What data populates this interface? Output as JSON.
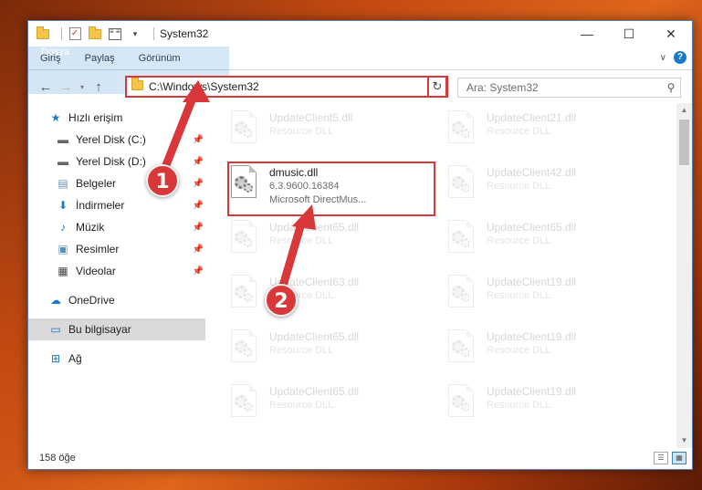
{
  "window": {
    "title": "System32"
  },
  "titlebar": {
    "minimize": "—",
    "maximize": "☐",
    "close": "✕"
  },
  "ribbon": {
    "tabs": [
      "Dosya",
      "Giriş",
      "Paylaş",
      "Görünüm"
    ],
    "help": "?"
  },
  "address": {
    "path": "C:\\Windows\\System32",
    "search_placeholder": "Ara: System32"
  },
  "nav": {
    "quick_access": "Hızlı erişim",
    "items": [
      "Yerel Disk (C:)",
      "Yerel Disk (D:)",
      "Belgeler",
      "İndirmeler",
      "Müzik",
      "Resimler",
      "Videolar"
    ],
    "onedrive": "OneDrive",
    "this_pc": "Bu bilgisayar",
    "network": "Ağ"
  },
  "files": [
    {
      "name": "UpdateClient5.dll",
      "sub1": "Resource DLL",
      "sub2": "",
      "active": false
    },
    {
      "name": "UpdateClient21.dll",
      "sub1": "Resource DLL",
      "sub2": "",
      "active": false
    },
    {
      "name": "dmusic.dll",
      "sub1": "6.3.9600.16384",
      "sub2": "Microsoft DirectMus...",
      "active": true
    },
    {
      "name": "UpdateClient42.dll",
      "sub1": "Resource DLL",
      "sub2": "",
      "active": false
    },
    {
      "name": "UpdateClient65.dll",
      "sub1": "Resource DLL",
      "sub2": "",
      "active": false
    },
    {
      "name": "UpdateClient65.dll",
      "sub1": "Resource DLL",
      "sub2": "",
      "active": false
    },
    {
      "name": "UpdateClient63.dll",
      "sub1": "Resource DLL",
      "sub2": "",
      "active": false
    },
    {
      "name": "UpdateClient19.dll",
      "sub1": "Resource DLL",
      "sub2": "",
      "active": false
    },
    {
      "name": "UpdateClient65.dll",
      "sub1": "Resource DLL",
      "sub2": "",
      "active": false
    },
    {
      "name": "UpdateClient19.dll",
      "sub1": "Resource DLL",
      "sub2": "",
      "active": false
    },
    {
      "name": "UpdateClient65.dll",
      "sub1": "Resource DLL",
      "sub2": "",
      "active": false
    },
    {
      "name": "UpdateClient19.dll",
      "sub1": "Resource DLL",
      "sub2": "",
      "active": false
    }
  ],
  "status": {
    "count": "158 öğe"
  },
  "callouts": [
    "1",
    "2"
  ],
  "colors": {
    "accent": "#1979ca",
    "highlight": "#d9383a"
  }
}
